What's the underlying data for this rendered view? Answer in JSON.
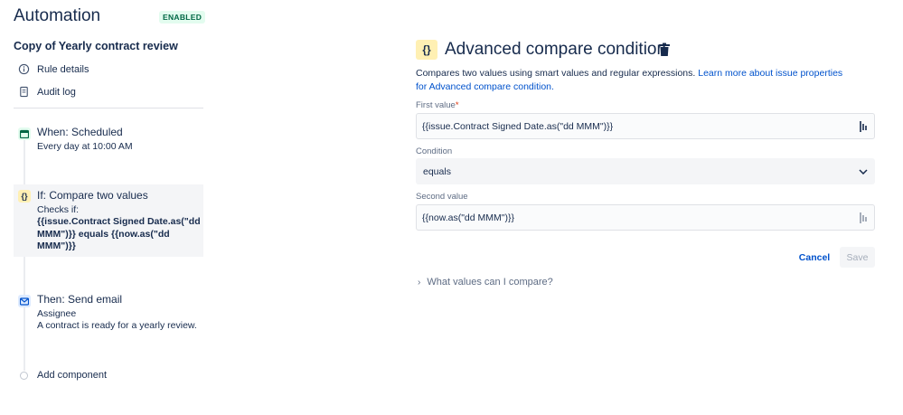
{
  "app": {
    "title": "Automation",
    "status_badge": "ENABLED"
  },
  "rule": {
    "name": "Copy of Yearly contract review"
  },
  "nav": [
    {
      "label": "Rule details",
      "icon": "info-icon"
    },
    {
      "label": "Audit log",
      "icon": "document-icon"
    }
  ],
  "steps": {
    "when": {
      "title": "When: Scheduled",
      "detail": "Every day at 10:00 AM",
      "icon": "calendar-icon"
    },
    "if": {
      "title": "If: Compare two values",
      "detail": "Checks if:",
      "expression": "{{issue.Contract Signed Date.as(\"dd MMM\")}} equals {{now.as(\"dd MMM\")}}",
      "icon": "curly-braces-icon"
    },
    "then": {
      "title": "Then: Send email",
      "detail_1": "Assignee",
      "detail_2": "A contract is ready for a yearly review.",
      "icon": "mail-icon"
    },
    "add_label": "Add component"
  },
  "panel": {
    "title": "Advanced compare condition",
    "icon_glyph": "{}",
    "description": "Compares two values using smart values and regular expressions. ",
    "link_text": "Learn more about issue properties for Advanced compare condition.",
    "first_value_label": "First value",
    "first_value_required": "*",
    "first_value": "{{issue.Contract Signed Date.as(\"dd MMM\")}}",
    "condition_label": "Condition",
    "condition_value": "equals",
    "second_value_label": "Second value",
    "second_value": "{{now.as(\"dd MMM\")}}",
    "cancel_label": "Cancel",
    "save_label": "Save",
    "expander_label": "What values can I compare?"
  },
  "colors": {
    "brand_blue": "#0052cc",
    "enabled_green": "#006644",
    "condition_yellow": "#fff0b3"
  }
}
